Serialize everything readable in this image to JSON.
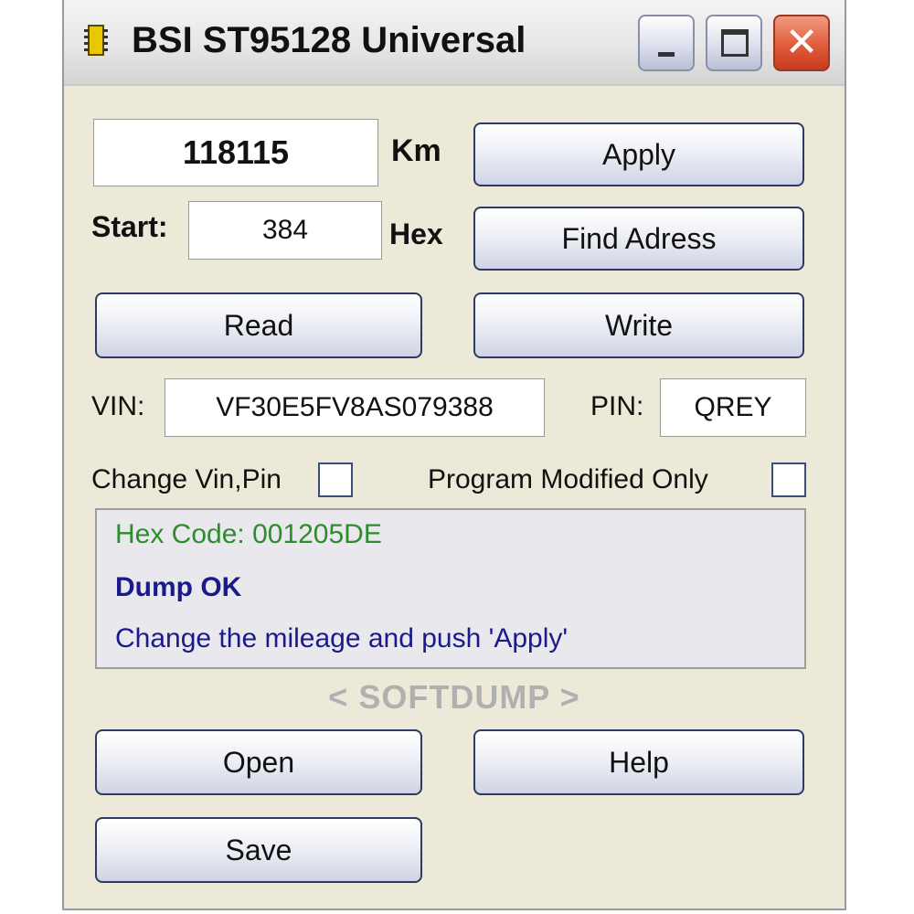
{
  "window": {
    "title": "BSI ST95128 Universal",
    "icon": "chip-icon",
    "controls": {
      "minimize": "minimize-icon",
      "maximize": "maximize-icon",
      "close": "close-icon",
      "close_glyph": "✕"
    }
  },
  "mileage": {
    "value": "118115",
    "unit": "Km"
  },
  "start": {
    "label": "Start:",
    "value": "384",
    "unit": "Hex"
  },
  "buttons": {
    "apply": "Apply",
    "find_address": "Find Adress",
    "read": "Read",
    "write": "Write",
    "open": "Open",
    "help": "Help",
    "save": "Save"
  },
  "vin": {
    "label": "VIN:",
    "value": "VF30E5FV8AS079388"
  },
  "pin": {
    "label": "PIN:",
    "value": "QREY"
  },
  "checkboxes": {
    "change_vin_pin": {
      "label": "Change Vin,Pin",
      "checked": false
    },
    "program_modified_only": {
      "label": "Program Modified Only",
      "checked": false
    }
  },
  "status": {
    "hex_code": "Hex Code: 001205DE",
    "result": "Dump OK",
    "instruction": "Change the mileage and push 'Apply'"
  },
  "brand": "< SOFTDUMP >",
  "colors": {
    "hex_code": "#2e8b2e",
    "status_text": "#1a1a8c",
    "brand": "#b0b0b0"
  }
}
